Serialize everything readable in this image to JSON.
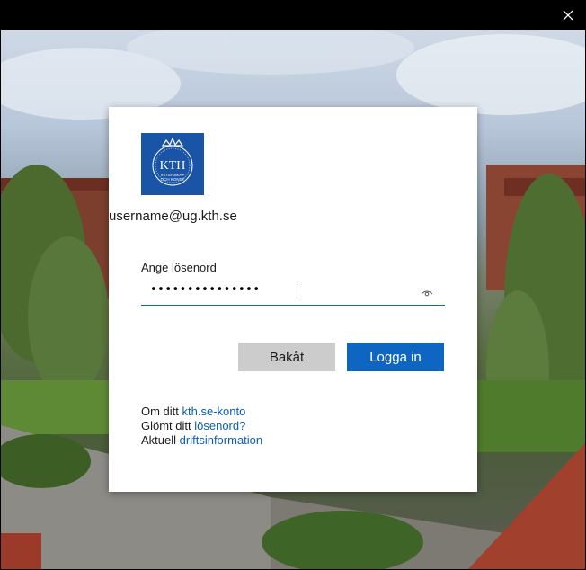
{
  "window": {
    "close_icon": "close-icon"
  },
  "logo": {
    "org": "KTH",
    "line1": "VETENSKAP",
    "line2": "OCH KONST",
    "color": "#1954a6"
  },
  "username": "username@ug.kth.se",
  "password": {
    "label": "Ange lösenord",
    "value": "•••••••••••••••",
    "reveal_icon": "eye-icon"
  },
  "buttons": {
    "back_label": "Bakåt",
    "login_label": "Logga in"
  },
  "links": [
    {
      "prefix": "Om ditt",
      "link": "kth.se-konto"
    },
    {
      "prefix": "Glömt ditt",
      "link": "lösenord?"
    },
    {
      "prefix": "Aktuell",
      "link": "driftsinformation"
    }
  ],
  "colors": {
    "accent": "#0f66c2",
    "link": "#0b5fb5",
    "secondary_button": "#cccccc"
  }
}
